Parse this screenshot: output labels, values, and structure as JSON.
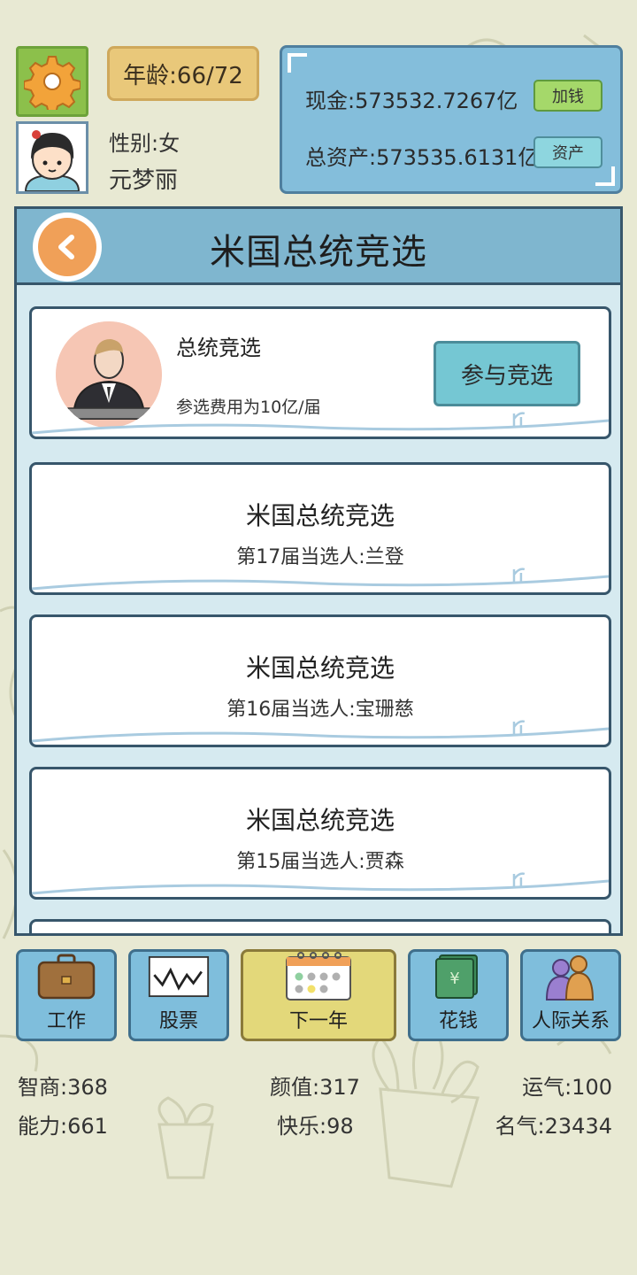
{
  "header": {
    "age_label": "年龄:66/72",
    "gender_label": "性别:女",
    "player_name": "元梦丽"
  },
  "money": {
    "cash_label": "现金:573532.7267亿",
    "assets_label": "总资产:573535.6131亿",
    "add_money_button": "加钱",
    "assets_button": "资产"
  },
  "panel": {
    "title": "米国总统竞选"
  },
  "campaign": {
    "title": "总统竞选",
    "fee": "参选费用为10亿/届",
    "join_button": "参与竞选"
  },
  "history": [
    {
      "title": "米国总统竞选",
      "winner": "第17届当选人:兰登"
    },
    {
      "title": "米国总统竞选",
      "winner": "第16届当选人:宝珊慈"
    },
    {
      "title": "米国总统竞选",
      "winner": "第15届当选人:贾森"
    }
  ],
  "nav": {
    "work": "工作",
    "stocks": "股票",
    "next_year": "下一年",
    "spend": "花钱",
    "relations": "人际关系"
  },
  "stats": {
    "iq": "智商:368",
    "looks": "颜值:317",
    "luck": "运气:100",
    "ability": "能力:661",
    "happiness": "快乐:98",
    "fame": "名气:23434"
  },
  "colors": {
    "background": "#e8e9d3",
    "panel_blue": "#84bedb",
    "header_blue": "#7fb6cf",
    "settings_green": "#8cc04b",
    "age_gold": "#e9c87a",
    "back_orange": "#f0a058",
    "next_year_yellow": "#e3d87a"
  }
}
